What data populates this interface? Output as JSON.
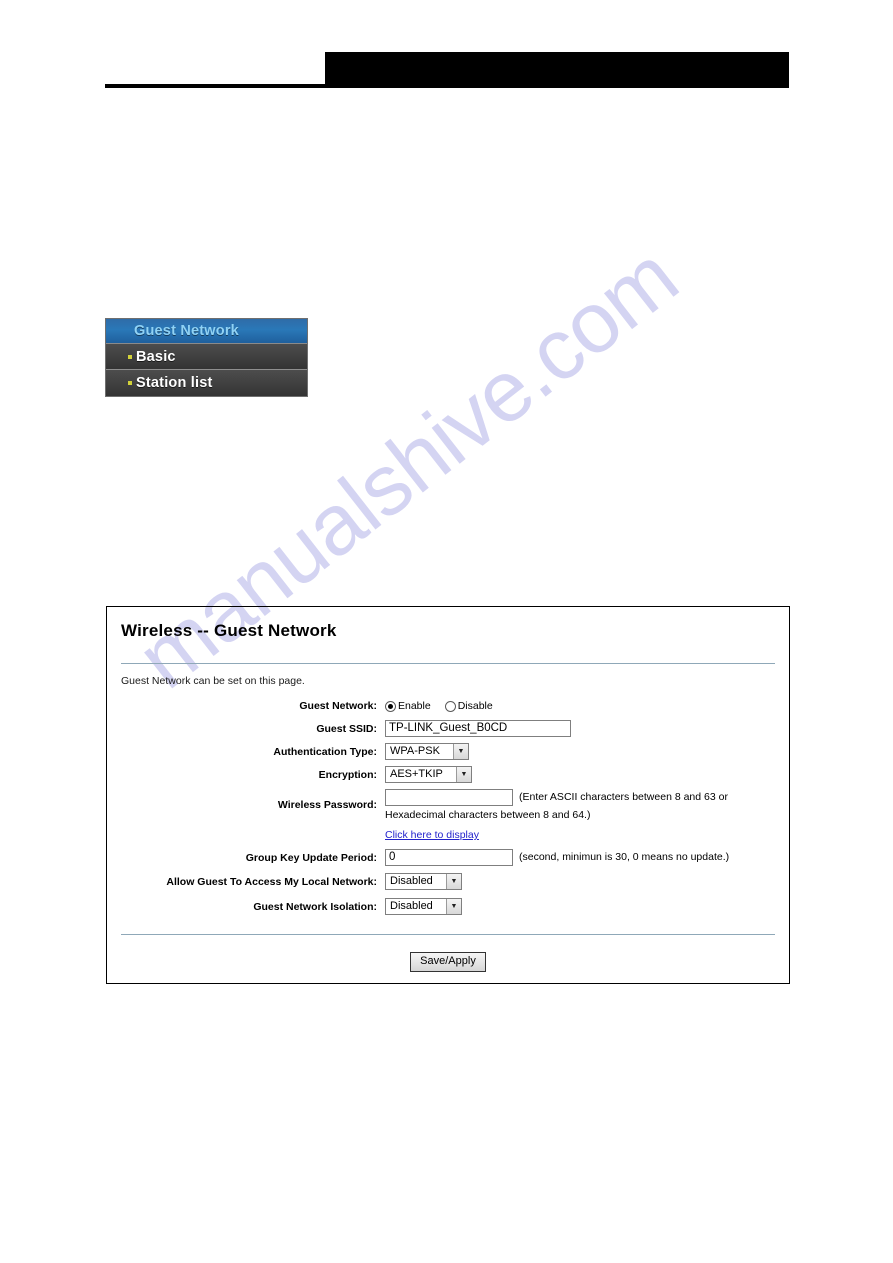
{
  "watermark": {
    "text": "manualshive.com"
  },
  "header": {
    "redacted": true
  },
  "menu": {
    "title": "Guest Network",
    "items": [
      {
        "label": "Basic"
      },
      {
        "label": "Station list"
      }
    ]
  },
  "panel": {
    "title": "Wireless -- Guest Network",
    "intro": "Guest Network can be set on this page.",
    "fields": {
      "guest_network": {
        "label": "Guest Network:",
        "options": [
          {
            "label": "Enable",
            "selected": true
          },
          {
            "label": "Disable",
            "selected": false
          }
        ]
      },
      "guest_ssid": {
        "label": "Guest SSID:",
        "value": "TP-LINK_Guest_B0CD",
        "placeholder": ""
      },
      "authentication_type": {
        "label": "Authentication Type:",
        "value": "WPA-PSK",
        "arrow": "chevron-down-icon"
      },
      "encryption": {
        "label": "Encryption:",
        "value": "AES+TKIP",
        "arrow": "chevron-down-icon"
      },
      "wireless_password": {
        "label": "Wireless Password:",
        "value": "",
        "placeholder": "",
        "hint_line1": "(Enter ASCII characters between 8 and 63 or",
        "hint_line2": "Hexadecimal characters between 8 and 64.)",
        "display_link": "Click here to display"
      },
      "group_key_update_period": {
        "label": "Group Key Update Period:",
        "value": "0",
        "placeholder": "",
        "hint": "(second, minimun is 30, 0 means no update.)"
      },
      "allow_guest_access": {
        "label": "Allow Guest To Access My Local Network:",
        "value": "Disabled",
        "arrow": "chevron-down-icon"
      },
      "guest_network_isolation": {
        "label": "Guest Network Isolation:",
        "value": "Disabled",
        "arrow": "chevron-down-icon"
      }
    },
    "actions": {
      "save_label": "Save/Apply"
    }
  },
  "colors": {
    "menu_header_blue": "#2a78b8",
    "menu_header_text": "#8fd2f5",
    "menu_item_bg": "#3f3f3f",
    "bullet": "#d2d23a",
    "divider": "#8fa8b8",
    "link": "#2222cc",
    "watermark": "#cdcdf0"
  }
}
